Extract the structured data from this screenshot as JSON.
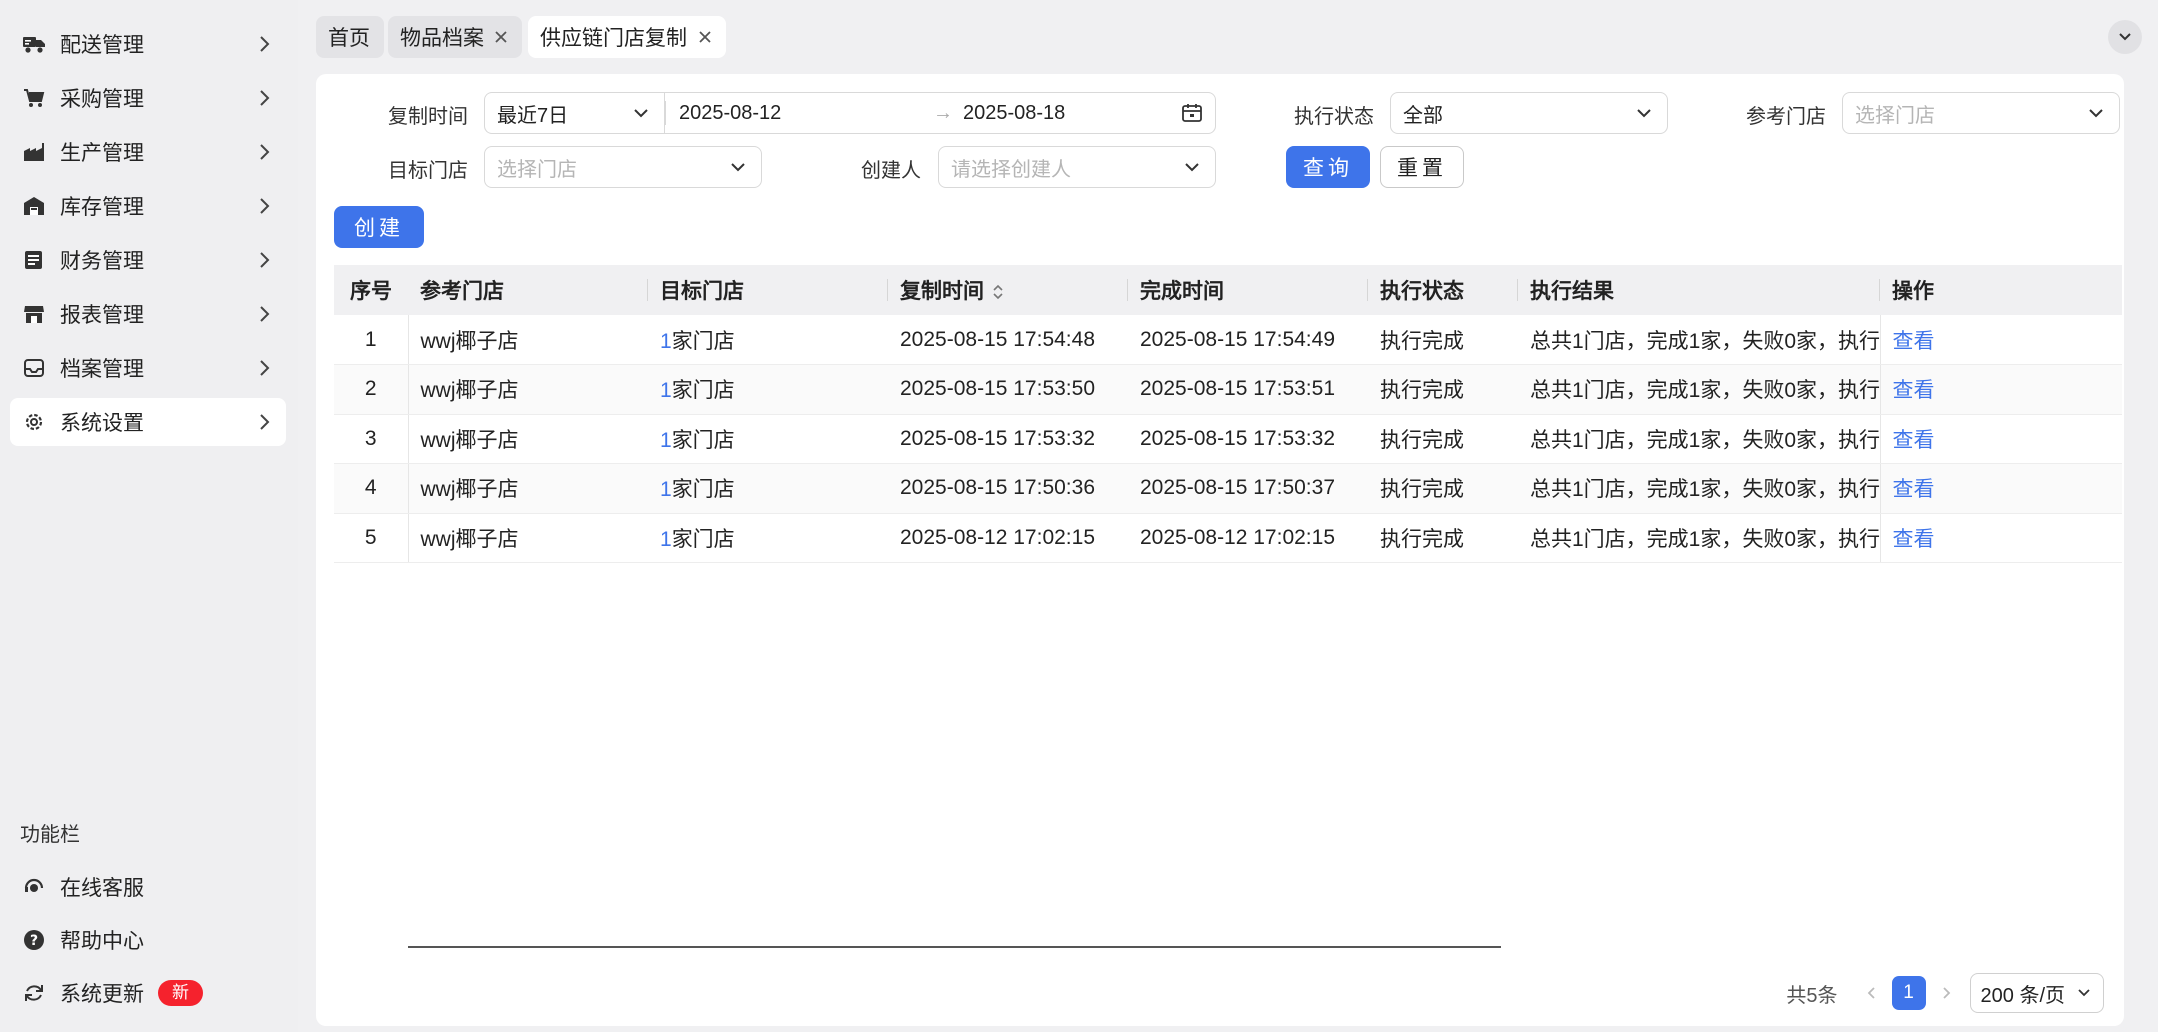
{
  "sidebar": {
    "items": [
      {
        "label": "配送管理",
        "icon": "truck-icon"
      },
      {
        "label": "采购管理",
        "icon": "cart-icon"
      },
      {
        "label": "生产管理",
        "icon": "factory-icon"
      },
      {
        "label": "库存管理",
        "icon": "warehouse-icon"
      },
      {
        "label": "财务管理",
        "icon": "ledger-icon"
      },
      {
        "label": "报表管理",
        "icon": "store-icon"
      },
      {
        "label": "档案管理",
        "icon": "inbox-icon"
      },
      {
        "label": "系统设置",
        "icon": "gear-icon"
      }
    ],
    "section_title": "功能栏",
    "utilities": [
      {
        "label": "在线客服",
        "icon": "headset-icon"
      },
      {
        "label": "帮助中心",
        "icon": "help-icon"
      },
      {
        "label": "系统更新",
        "icon": "refresh-icon",
        "badge": "新"
      }
    ]
  },
  "tabs": [
    {
      "label": "首页"
    },
    {
      "label": "物品档案"
    },
    {
      "label": "供应链门店复制"
    }
  ],
  "filters": {
    "copy_time_label": "复制时间",
    "range_preset": "最近7日",
    "date_start": "2025-08-12",
    "date_end": "2025-08-18",
    "date_sep": "→",
    "status_label": "执行状态",
    "status_value": "全部",
    "ref_store_label": "参考门店",
    "ref_store_placeholder": "选择门店",
    "target_store_label": "目标门店",
    "target_store_placeholder": "选择门店",
    "creator_label": "创建人",
    "creator_placeholder": "请选择创建人",
    "query_button": "查询",
    "reset_button": "重置",
    "create_button": "创建"
  },
  "table": {
    "columns": [
      "序号",
      "参考门店",
      "目标门店",
      "复制时间",
      "完成时间",
      "执行状态",
      "执行结果",
      "操作"
    ],
    "rows": [
      {
        "seq": "1",
        "ref": "wwj椰子店",
        "target_num": "1",
        "target_text": "家门店",
        "copy_time": "2025-08-15 17:54:48",
        "done_time": "2025-08-15 17:54:49",
        "status": "执行完成",
        "result": "总共1门店，完成1家，失败0家，执行",
        "action": "查看"
      },
      {
        "seq": "2",
        "ref": "wwj椰子店",
        "target_num": "1",
        "target_text": "家门店",
        "copy_time": "2025-08-15 17:53:50",
        "done_time": "2025-08-15 17:53:51",
        "status": "执行完成",
        "result": "总共1门店，完成1家，失败0家，执行",
        "action": "查看"
      },
      {
        "seq": "3",
        "ref": "wwj椰子店",
        "target_num": "1",
        "target_text": "家门店",
        "copy_time": "2025-08-15 17:53:32",
        "done_time": "2025-08-15 17:53:32",
        "status": "执行完成",
        "result": "总共1门店，完成1家，失败0家，执行",
        "action": "查看"
      },
      {
        "seq": "4",
        "ref": "wwj椰子店",
        "target_num": "1",
        "target_text": "家门店",
        "copy_time": "2025-08-15 17:50:36",
        "done_time": "2025-08-15 17:50:37",
        "status": "执行完成",
        "result": "总共1门店，完成1家，失败0家，执行",
        "action": "查看"
      },
      {
        "seq": "5",
        "ref": "wwj椰子店",
        "target_num": "1",
        "target_text": "家门店",
        "copy_time": "2025-08-12 17:02:15",
        "done_time": "2025-08-12 17:02:15",
        "status": "执行完成",
        "result": "总共1门店，完成1家，失败0家，执行",
        "action": "查看"
      }
    ]
  },
  "pagination": {
    "total": "共5条",
    "current_page": "1",
    "page_size": "200 条/页"
  },
  "colors": {
    "primary": "#3e74ea",
    "badge": "#f5222d"
  }
}
